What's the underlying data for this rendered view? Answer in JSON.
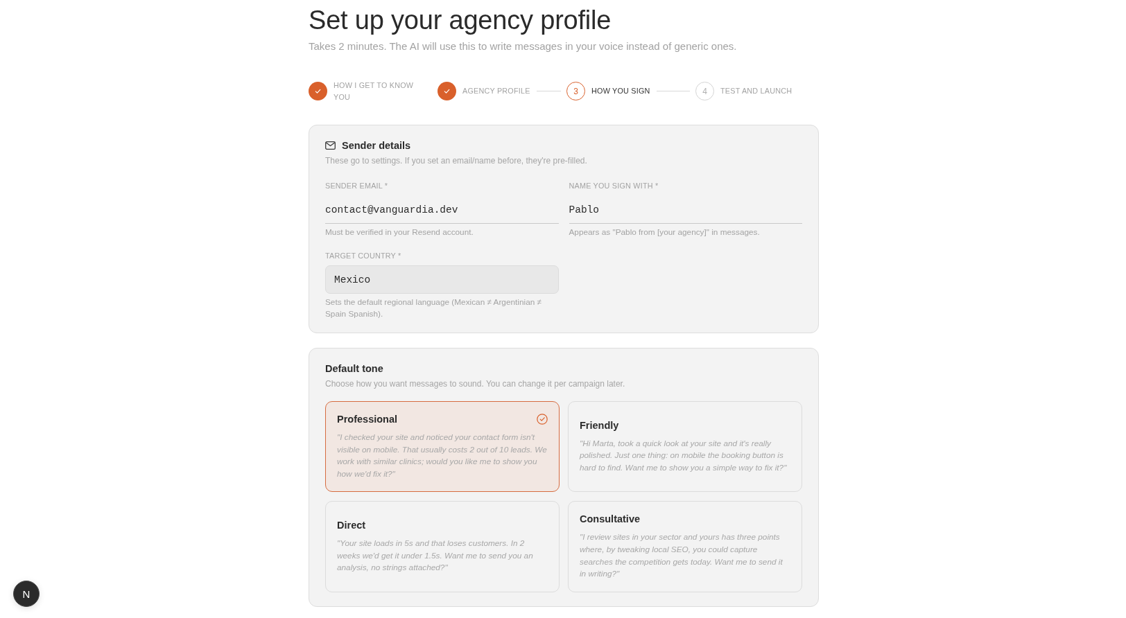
{
  "header": {
    "title": "Set up your agency profile",
    "subtitle": "Takes 2 minutes. The AI will use this to write messages in your voice instead of generic ones."
  },
  "steps": [
    {
      "label": "HOW I GET TO KNOW YOU",
      "completed": true,
      "active": false
    },
    {
      "label": "AGENCY PROFILE",
      "completed": true,
      "active": false
    },
    {
      "label": "HOW YOU SIGN",
      "number": "3",
      "completed": false,
      "active": true
    },
    {
      "label": "TEST AND LAUNCH",
      "number": "4",
      "completed": false,
      "active": false
    }
  ],
  "sender_details": {
    "title": "Sender details",
    "description": "These go to settings. If you set an email/name before, they're pre-filled.",
    "fields": [
      {
        "kind": "text",
        "label": "SENDER EMAIL *",
        "value": "contact@vanguardia.dev",
        "hint": "Must be verified in your Resend account."
      },
      {
        "kind": "text",
        "label": "NAME YOU SIGN WITH *",
        "value": "Pablo",
        "hint": "Appears as \"Pablo from [your agency]\" in messages."
      },
      {
        "kind": "select",
        "label": "TARGET COUNTRY *",
        "value": "Mexico",
        "hint": "Sets the default regional language (Mexican ≠ Argentinian ≠ Spain Spanish)."
      }
    ]
  },
  "default_tone": {
    "title": "Default tone",
    "description": "Choose how you want messages to sound. You can change it per campaign later.",
    "options": [
      {
        "name": "Professional",
        "sample": "\"I checked your site and noticed your contact form isn't visible on mobile. That usually costs 2 out of 10 leads. We work with similar clinics; would you like me to show you how we'd fix it?\"",
        "selected": true
      },
      {
        "name": "Friendly",
        "sample": "\"Hi Marta, took a quick look at your site and it's really polished. Just one thing: on mobile the booking button is hard to find. Want me to show you a simple way to fix it?\"",
        "selected": false
      },
      {
        "name": "Direct",
        "sample": "\"Your site loads in 5s and that loses customers. In 2 weeks we'd get it under 1.5s. Want me to send you an analysis, no strings attached?\"",
        "selected": false
      },
      {
        "name": "Consultative",
        "sample": "\"I review sites in your sector and yours has three points where, by tweaking local SEO, you could capture searches the competition gets today. Want me to send it in writing?\"",
        "selected": false
      }
    ]
  },
  "dev_badge": {
    "label": "N"
  }
}
